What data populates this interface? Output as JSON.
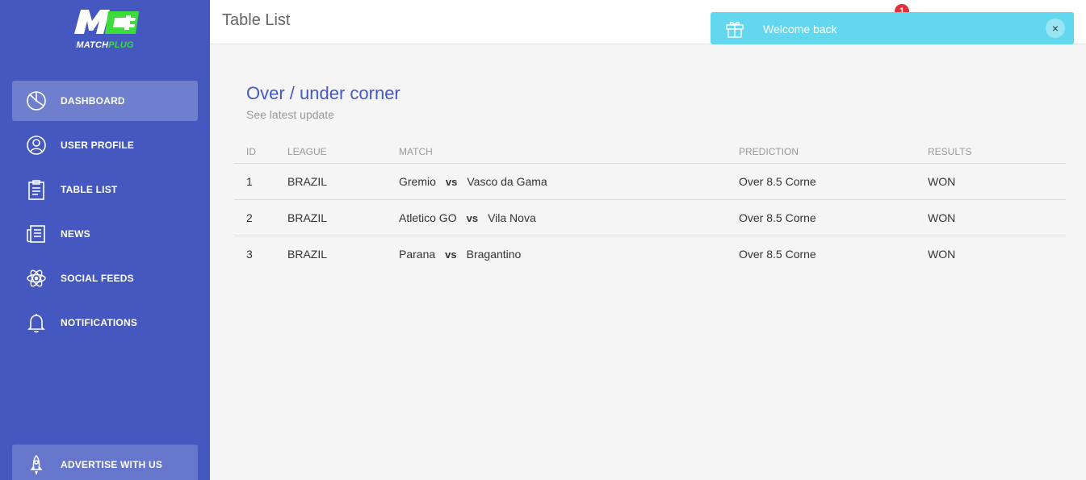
{
  "brand": {
    "logo_letter": "M",
    "logo_word_a": "MATCH",
    "logo_word_b": "PLUG",
    "accent": "#3ddc3d",
    "sidebar_color": "#4558c0"
  },
  "sidebar": {
    "items": [
      {
        "label": "DASHBOARD",
        "icon": "pie-chart-icon",
        "active": true
      },
      {
        "label": "USER PROFILE",
        "icon": "user-icon",
        "active": false
      },
      {
        "label": "TABLE LIST",
        "icon": "clipboard-icon",
        "active": false
      },
      {
        "label": "NEWS",
        "icon": "newspaper-icon",
        "active": false
      },
      {
        "label": "SOCIAL FEEDS",
        "icon": "atom-icon",
        "active": false
      },
      {
        "label": "NOTIFICATIONS",
        "icon": "bell-icon",
        "active": false
      }
    ],
    "bottom": {
      "label": "ADVERTISE WITH US",
      "icon": "rocket-icon"
    }
  },
  "topbar": {
    "title": "Table List",
    "notification_count": "1"
  },
  "toast": {
    "message": "Welcome back",
    "icon": "gift-icon",
    "close": "×",
    "color": "#62d7ee"
  },
  "card": {
    "title": "Over / under corner",
    "subtitle": "See latest update",
    "headers": [
      "ID",
      "LEAGUE",
      "MATCH",
      "PREDICTION",
      "RESULTS"
    ],
    "rows": [
      {
        "id": "1",
        "league": "BRAZIL",
        "home": "Gremio",
        "vs": "vs",
        "away": "Vasco da Gama",
        "prediction": "Over 8.5 Corne",
        "result": "WON"
      },
      {
        "id": "2",
        "league": "BRAZIL",
        "home": "Atletico GO",
        "vs": "vs",
        "away": "Vila Nova",
        "prediction": "Over 8.5 Corne",
        "result": "WON"
      },
      {
        "id": "3",
        "league": "BRAZIL",
        "home": "Parana",
        "vs": "vs",
        "away": "Bragantino",
        "prediction": "Over 8.5 Corne",
        "result": "WON"
      }
    ]
  }
}
